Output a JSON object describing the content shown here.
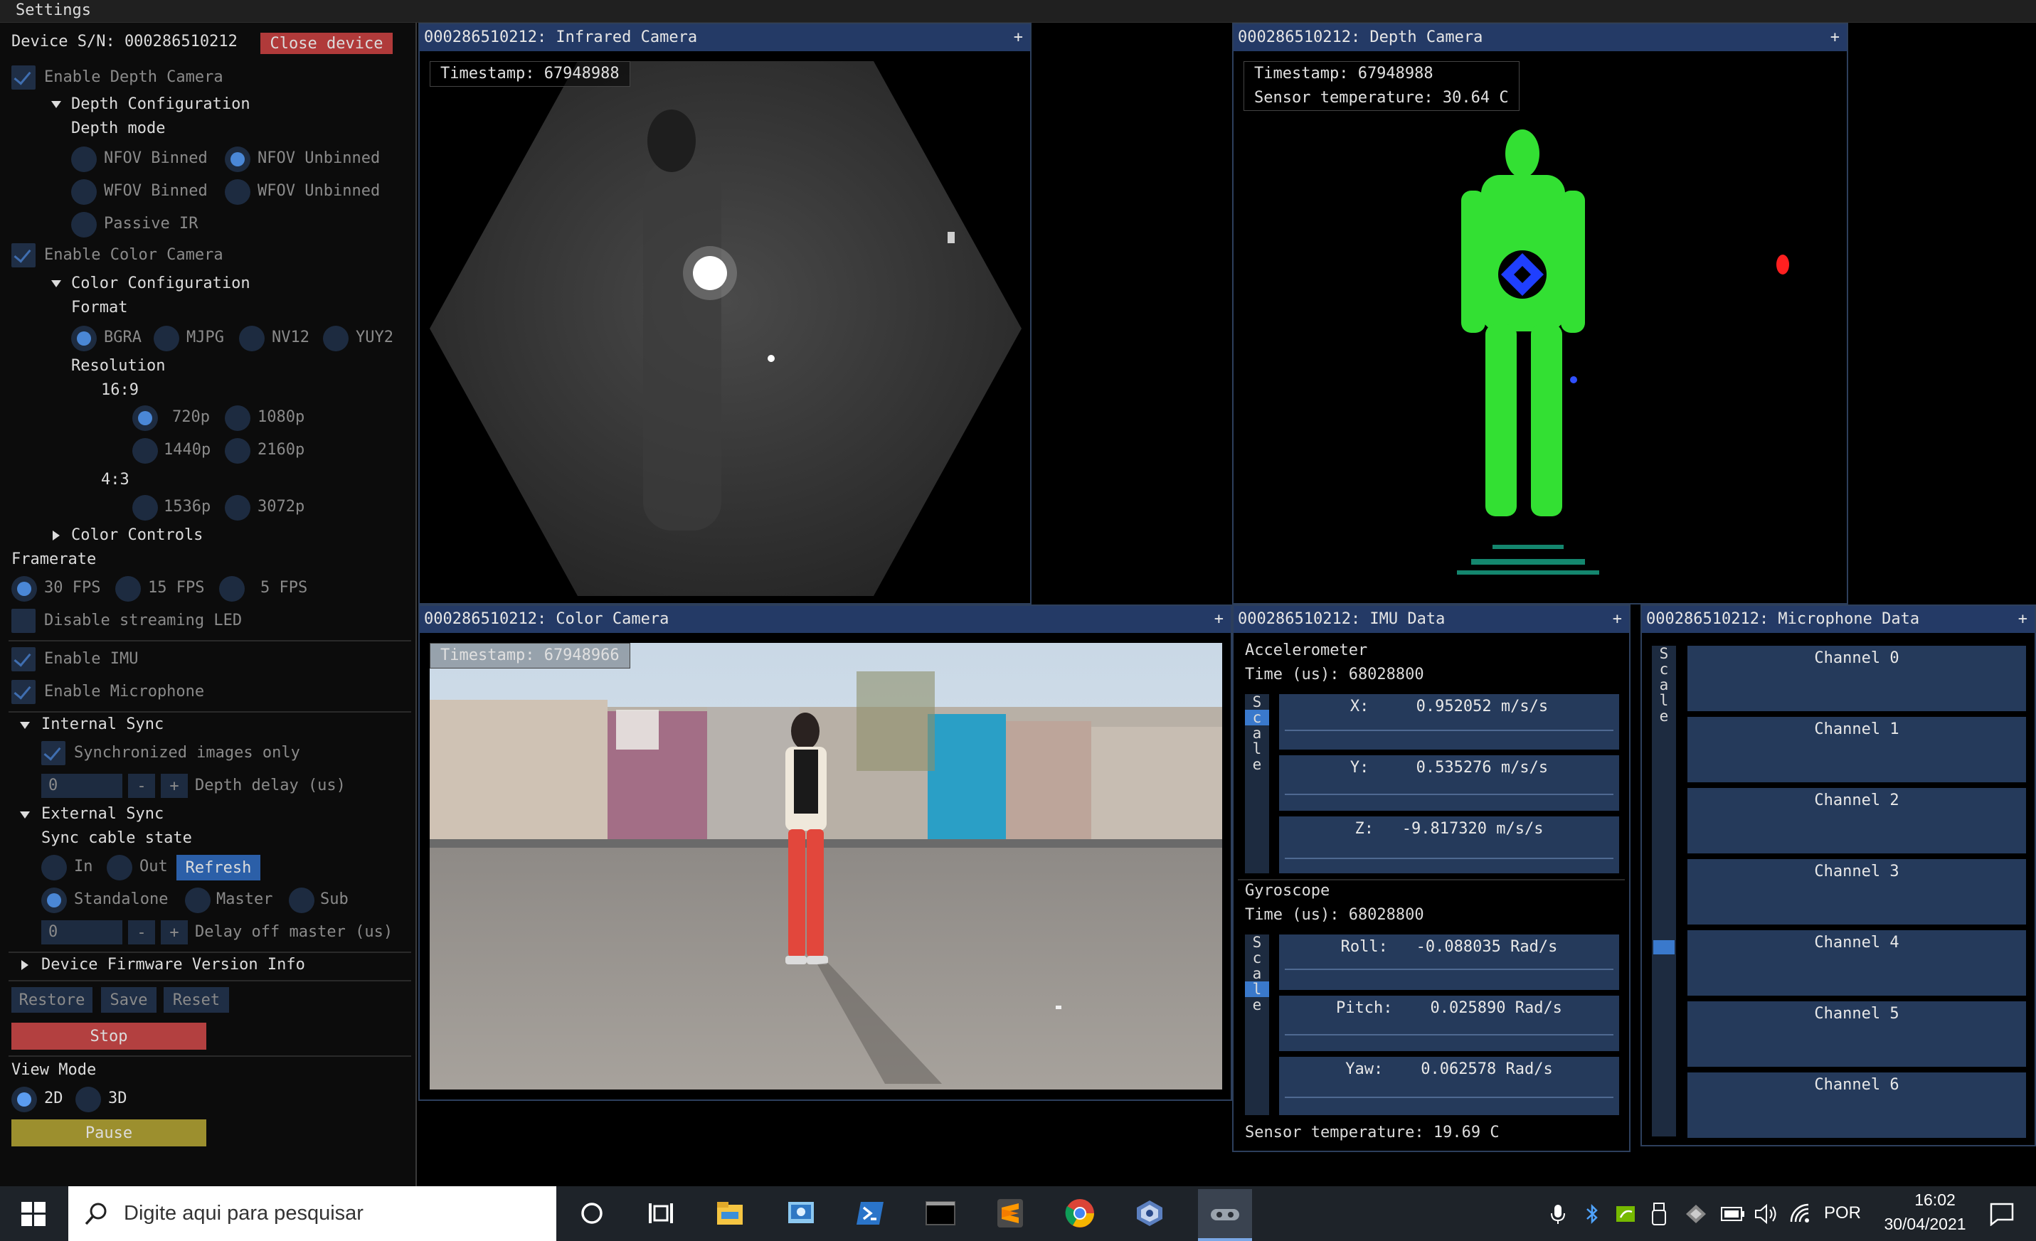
{
  "app": {
    "title": "Settings"
  },
  "settings": {
    "device_label": "Device S/N: 000286510212",
    "close_device": "Close device",
    "enable_depth": "Enable Depth Camera",
    "depth_config": "Depth Configuration",
    "depth_mode": "Depth mode",
    "depth_modes": [
      "NFOV Binned",
      "NFOV Unbinned",
      "WFOV Binned",
      "WFOV Unbinned",
      "Passive IR"
    ],
    "enable_color": "Enable Color Camera",
    "color_config": "Color Configuration",
    "format": "Format",
    "formats": [
      "BGRA",
      "MJPG",
      "NV12",
      "YUY2"
    ],
    "resolution": "Resolution",
    "ratio_169": "16:9",
    "res_169": [
      "720p",
      "1080p",
      "1440p",
      "2160p"
    ],
    "ratio_43": "4:3",
    "res_43": [
      "1536p",
      "3072p"
    ],
    "color_controls": "Color Controls",
    "framerate": "Framerate",
    "fps": [
      "30 FPS",
      "15 FPS",
      "5 FPS"
    ],
    "disable_led": "Disable streaming LED",
    "enable_imu": "Enable IMU",
    "enable_mic": "Enable Microphone",
    "internal_sync": "Internal Sync",
    "sync_images": "Synchronized images only",
    "depth_delay_value": "0",
    "depth_delay_label": "Depth delay (us)",
    "minus": "-",
    "plus": "+",
    "external_sync": "External Sync",
    "sync_cable": "Sync cable state",
    "sync_in": "In",
    "sync_out": "Out",
    "refresh": "Refresh",
    "sync_modes": [
      "Standalone",
      "Master",
      "Sub"
    ],
    "master_delay_value": "0",
    "master_delay_label": "Delay off master (us)",
    "firmware_info": "Device Firmware Version Info",
    "restore": "Restore",
    "save": "Save",
    "reset": "Reset",
    "stop": "Stop",
    "view_mode": "View Mode",
    "view_2d": "2D",
    "view_3d": "3D",
    "pause": "Pause"
  },
  "windows": {
    "plus": "+",
    "infrared": {
      "title": "000286510212: Infrared Camera",
      "timestamp": "Timestamp: 67948988"
    },
    "depth": {
      "title": "000286510212: Depth Camera",
      "timestamp": "Timestamp: 67948988",
      "temperature": "Sensor temperature: 30.64 C"
    },
    "color": {
      "title": "000286510212: Color Camera",
      "timestamp": "Timestamp: 67948966"
    },
    "imu": {
      "title": "000286510212: IMU Data",
      "accel_label": "Accelerometer",
      "accel_time": "Time (us): 68028800",
      "accel": [
        "X:     0.952052 m/s/s",
        "Y:     0.535276 m/s/s",
        "Z:   -9.817320 m/s/s"
      ],
      "gyro_label": "Gyroscope",
      "gyro_time": "Time (us): 68028800",
      "gyro": [
        "Roll:   -0.088035 Rad/s",
        "Pitch:    0.025890 Rad/s",
        "Yaw:    0.062578 Rad/s"
      ],
      "sensor_temp": "Sensor temperature: 19.69 C",
      "scale": [
        "S",
        "c",
        "a",
        "l",
        "e"
      ]
    },
    "mic": {
      "title": "000286510212: Microphone Data",
      "channels": [
        "Channel 0",
        "Channel 1",
        "Channel 2",
        "Channel 3",
        "Channel 4",
        "Channel 5",
        "Channel 6"
      ],
      "scale": [
        "S",
        "c",
        "a",
        "l",
        "e"
      ]
    }
  },
  "taskbar": {
    "search_placeholder": "Digite aqui para pesquisar",
    "lang": "POR",
    "time": "16:02",
    "date": "30/04/2021"
  },
  "colors": {
    "accent": "#4a87d6",
    "title_bar": "#243a66",
    "close_btn": "#b03a3a",
    "stop_btn": "#b34040",
    "pause_btn": "#9c8f2e"
  }
}
